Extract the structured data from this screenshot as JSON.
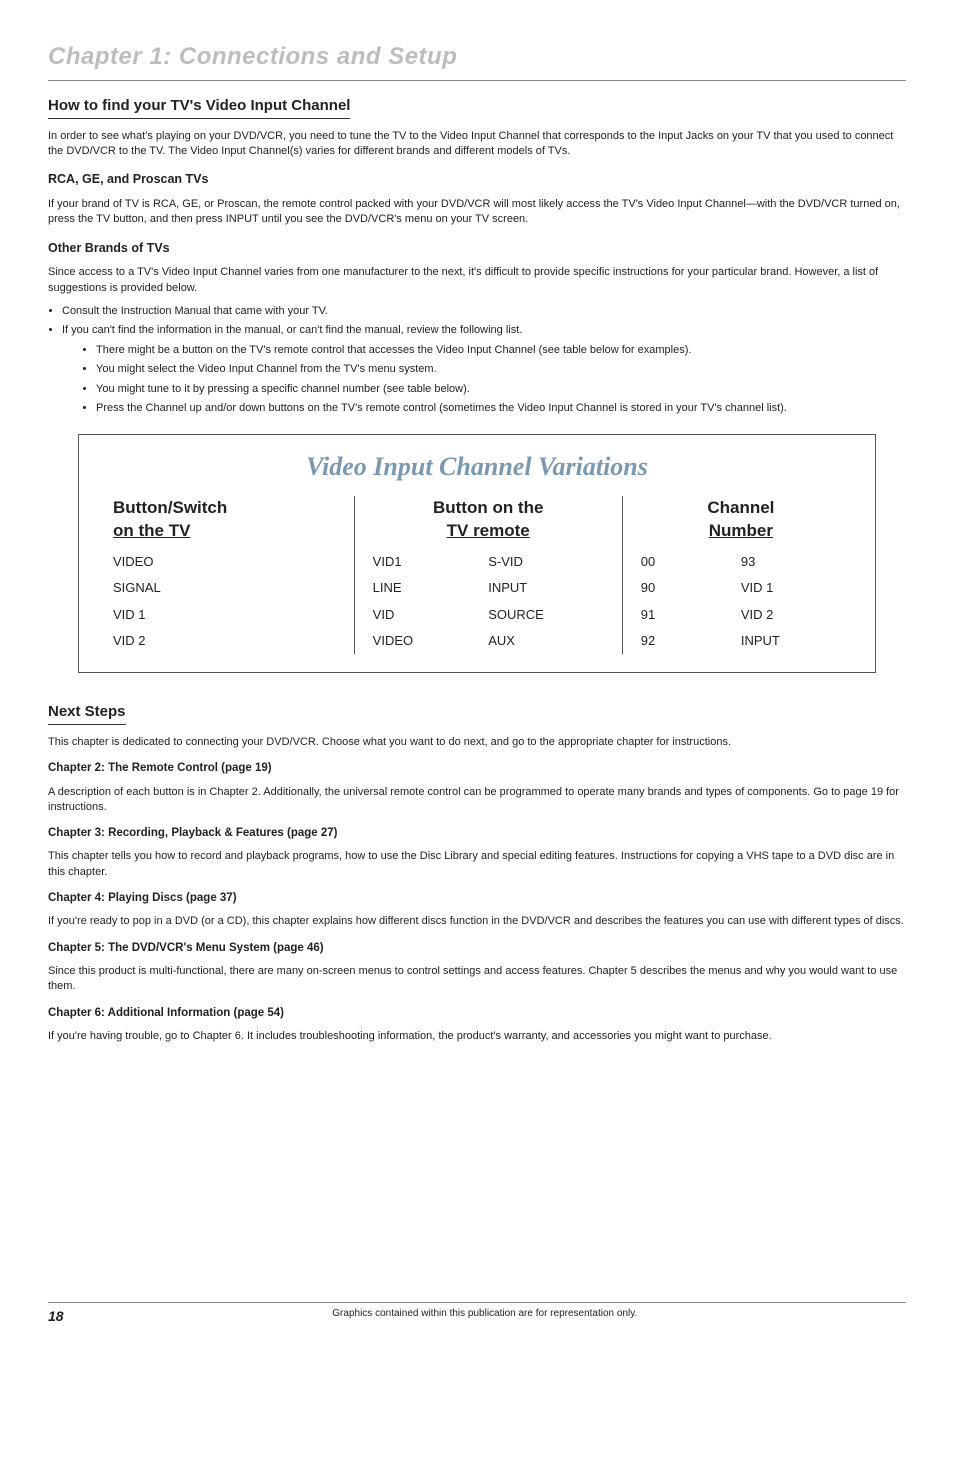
{
  "chapter": "Chapter 1: Connections and Setup",
  "sec1": {
    "title": "How to find your TV's Video Input Channel",
    "intro": "In order to see what's playing on your DVD/VCR, you need to tune the TV to the Video Input Channel that corresponds to the Input Jacks on your TV that you used to connect the DVD/VCR to the TV. The Video Input Channel(s) varies for different brands and different models of TVs.",
    "sub1": {
      "title": "RCA, GE, and Proscan TVs",
      "text": "If your brand of TV is RCA, GE, or Proscan, the remote control packed with your DVD/VCR will most likely access the TV's Video Input Channel—with the DVD/VCR turned on, press the TV button, and then press INPUT until you see the DVD/VCR's menu on your TV screen."
    },
    "sub2": {
      "title": "Other Brands of TVs",
      "text": "Since access to a TV's Video Input Channel varies from one manufacturer to the next, it's difficult to provide specific instructions for your particular brand. However, a list of suggestions is provided below.",
      "b1": "Consult the Instruction Manual that came with your TV.",
      "b2": "If you can't find the information in the manual, or can't find the manual, review the following list.",
      "i1": "There might be a button on the TV's remote control that accesses the Video Input Channel (see table below for examples).",
      "i2": "You might select the Video Input Channel from the TV's menu system.",
      "i3": "You might tune to it by pressing a specific channel number (see table below).",
      "i4": "Press the Channel up and/or down buttons on the TV's remote control (sometimes the Video Input Channel is stored in your TV's channel list)."
    }
  },
  "table": {
    "title": "Video Input Channel Variations",
    "h1a": "Button/Switch",
    "h1b": "on the TV",
    "h2a": "Button on the",
    "h2b": "TV remote",
    "h3a": "Channel",
    "h3b": "Number",
    "col1": {
      "r1": "VIDEO",
      "r2": "SIGNAL",
      "r3": "VID 1",
      "r4": "VID 2"
    },
    "col2": {
      "r1a": "VID1",
      "r1b": "S-VID",
      "r2a": "LINE",
      "r2b": "INPUT",
      "r3a": "VID",
      "r3b": "SOURCE",
      "r4a": "VIDEO",
      "r4b": "AUX"
    },
    "col3": {
      "r1a": "00",
      "r1b": "93",
      "r2a": "90",
      "r2b": "VID 1",
      "r3a": "91",
      "r3b": "VID 2",
      "r4a": "92",
      "r4b": "INPUT"
    }
  },
  "sec2": {
    "title": "Next Steps",
    "intro": "This chapter is dedicated to connecting your DVD/VCR. Choose what you want to do next, and go to the appropriate chapter for instructions.",
    "c2h": "Chapter 2: The Remote Control (page 19)",
    "c2t": "A description of each button is in Chapter 2. Additionally, the universal remote control can be programmed to operate many brands and types of components. Go to page 19 for instructions.",
    "c3h": "Chapter 3: Recording, Playback & Features (page 27)",
    "c3t": "This chapter tells you how to record and playback programs, how to use the Disc Library and special editing features. Instructions for copying a VHS tape to a DVD disc are in this chapter.",
    "c4h": "Chapter 4: Playing Discs (page 37)",
    "c4t": "If you're ready to pop in a DVD (or a CD), this chapter explains how different discs function in the DVD/VCR and describes the features you can use with different types of discs.",
    "c5h": "Chapter 5: The DVD/VCR's Menu System (page 46)",
    "c5t": "Since this product is multi-functional, there are many on-screen menus to control settings and access features. Chapter 5 describes the menus and why you would want to use them.",
    "c6h": "Chapter 6: Additional Information (page 54)",
    "c6t": "If you're having trouble, go to Chapter 6. It includes troubleshooting information, the product's warranty, and accessories you might want to purchase."
  },
  "footer": {
    "page": "18",
    "text": "Graphics contained within this publication are for representation only."
  }
}
